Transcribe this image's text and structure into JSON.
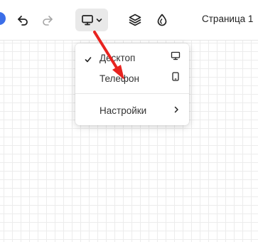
{
  "toolbar": {
    "page_label": "Страница 1",
    "icons": [
      "undo-icon",
      "redo-icon",
      "monitor-icon",
      "chevron-down-icon",
      "layers-icon",
      "drop-icon"
    ]
  },
  "device_menu": {
    "items": [
      {
        "label": "Десктоп",
        "checked": true,
        "icon": "monitor-icon"
      },
      {
        "label": "Телефон",
        "checked": false,
        "icon": "phone-icon"
      }
    ],
    "settings_label": "Настройки",
    "settings_icon": "chevron-right-icon"
  },
  "annotation": {
    "color": "#e8231f",
    "icon": "red-arrow"
  }
}
